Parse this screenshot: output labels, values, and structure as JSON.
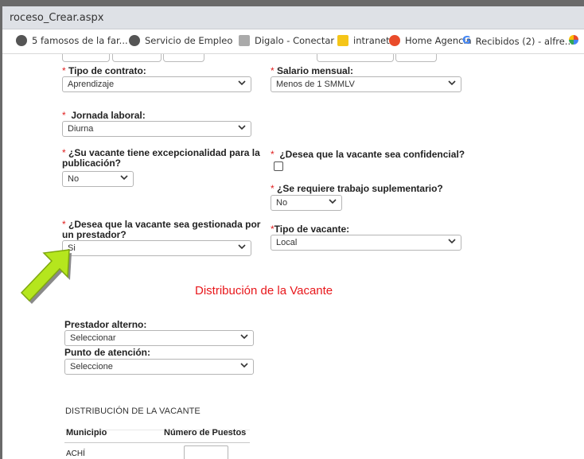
{
  "window": {
    "title": "roceso_Crear.aspx"
  },
  "bookmarks": [
    {
      "label": "5 famosos de la far...",
      "icon": "globe-icon",
      "color": "#555555"
    },
    {
      "label": "Servicio de Empleo",
      "icon": "globe-icon",
      "color": "#555555"
    },
    {
      "label": "Digalo - Conectar",
      "icon": "page-icon",
      "color": "#999999"
    },
    {
      "label": "intranet",
      "icon": "folder-icon",
      "color": "#f5c518"
    },
    {
      "label": "Home Agencia",
      "icon": "agency-icon",
      "color": "#e94b2a"
    },
    {
      "label": "Recibidos (2) - alfre...",
      "icon": "google-icon",
      "color": "#4285f4"
    }
  ],
  "form": {
    "tipo_contrato": {
      "label": "Tipo de contrato:",
      "value": "Aprendizaje"
    },
    "salario": {
      "label": "Salario mensual:",
      "value": "Menos de 1 SMMLV"
    },
    "jornada": {
      "label": "Jornada laboral:",
      "value": "Diurna"
    },
    "excepcionalidad": {
      "label_line1": "¿Su vacante tiene excepcionalidad para la",
      "label_line2": "publicación?",
      "value": "No"
    },
    "confidencial": {
      "label": "¿Desea que la vacante sea confidencial?",
      "checked": false
    },
    "suplementario": {
      "label": "¿Se requiere trabajo suplementario?",
      "value": "No"
    },
    "gestionada": {
      "label_line1": "¿Desea que la vacante sea gestionada por",
      "label_line2": "un prestador?",
      "value": "Si"
    },
    "tipo_vacante": {
      "label": "Tipo de vacante:",
      "value": "Local"
    },
    "required_mark": "*"
  },
  "distribucion": {
    "section_title": "Distribución de la Vacante",
    "prestador_alterno": {
      "label": "Prestador alterno:",
      "value": "Seleccionar"
    },
    "punto_atencion": {
      "label": "Punto de atención:",
      "value": "Seleccione"
    },
    "table_title": "DISTRIBUCIÓN DE LA VACANTE",
    "columns": [
      "Municipio",
      "Número de Puestos"
    ],
    "rows": [
      {
        "municipio": "ACHÍ",
        "puestos": ""
      }
    ]
  },
  "colors": {
    "required": "#e02020",
    "section_title": "#e8171b",
    "arrow": "#b5e61d"
  }
}
